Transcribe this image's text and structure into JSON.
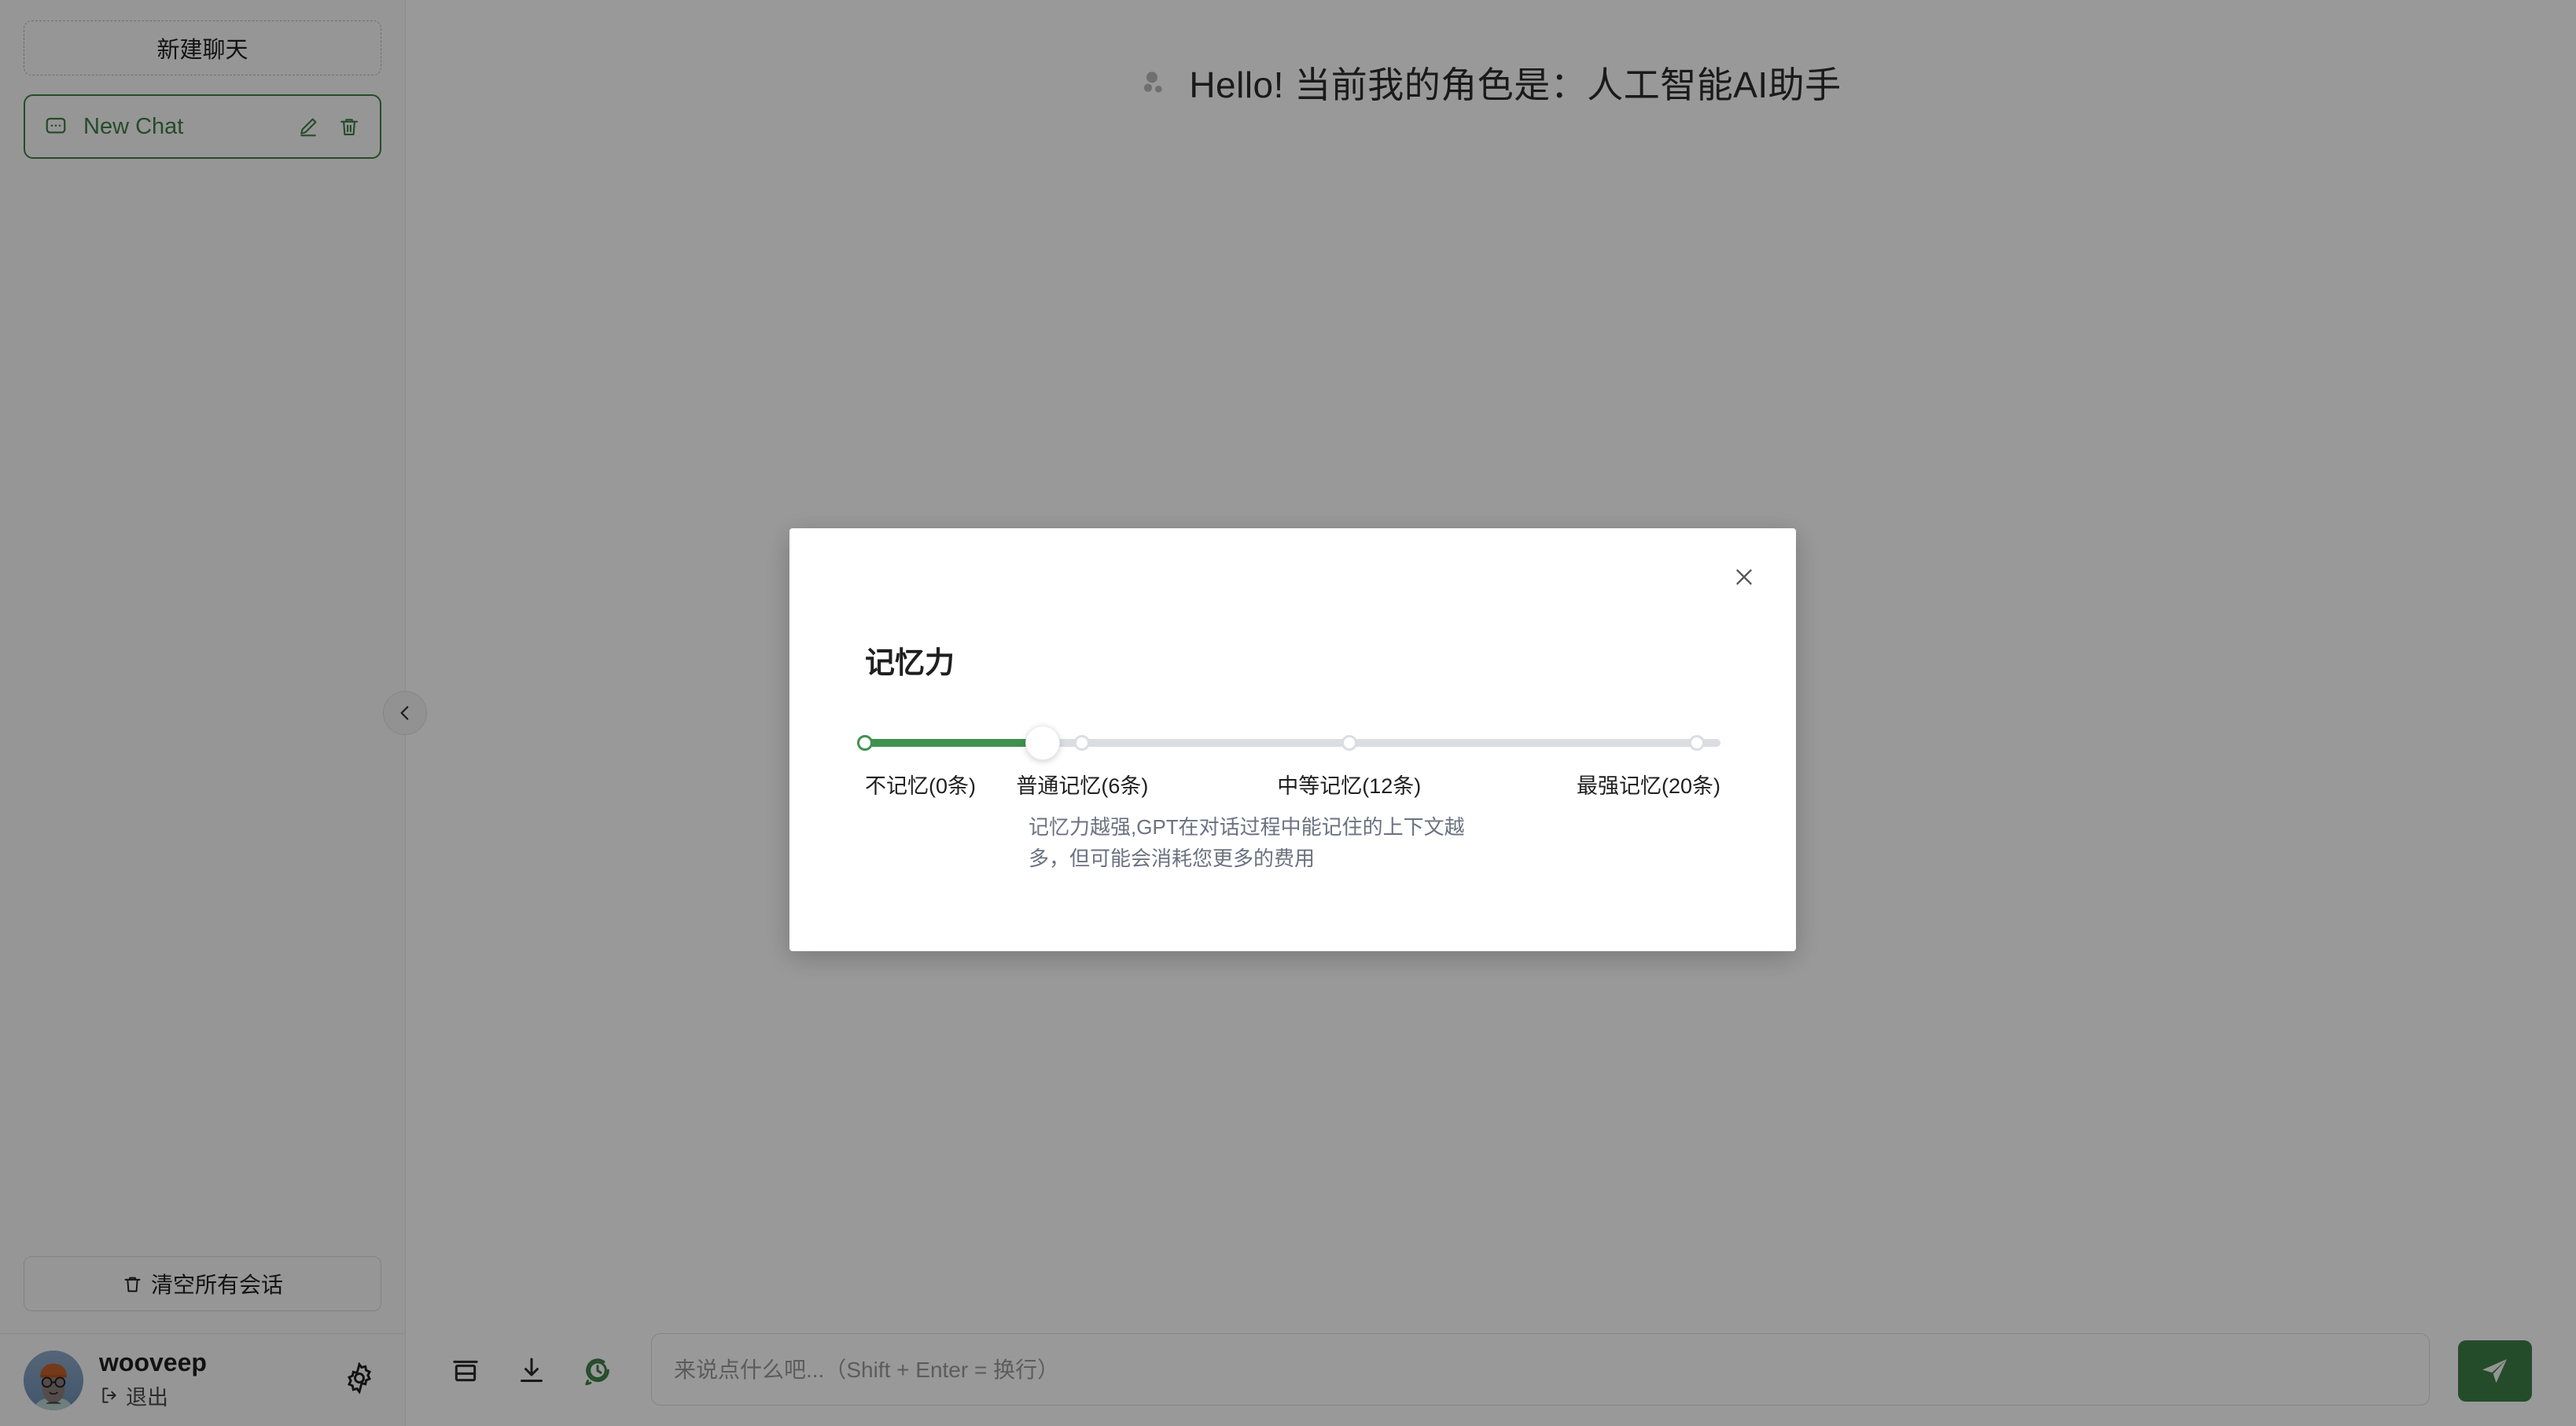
{
  "sidebar": {
    "new_chat_button": "新建聊天",
    "chat_items": [
      {
        "title": "New Chat",
        "chat_icon": "chat-bubble-icon",
        "edit_icon": "pencil-icon",
        "delete_icon": "trash-icon",
        "active": true
      }
    ],
    "clear_all_button": "清空所有会话",
    "clear_icon": "trash-icon",
    "user": {
      "name": "wooveep",
      "logout_label": "退出",
      "logout_icon": "sign-out-icon",
      "avatar_icon": "user-avatar",
      "settings_icon": "gear-icon"
    },
    "collapse_icon": "chevron-left-icon",
    "accent_color": "#3f7f47"
  },
  "main": {
    "greeting": "Hello! 当前我的角色是：人工智能AI助手",
    "greeting_icon": "dots-cluster-icon",
    "composer": {
      "tools": [
        {
          "name": "archive-icon",
          "label": "存档"
        },
        {
          "name": "download-icon",
          "label": "下载"
        },
        {
          "name": "history-clock-icon",
          "label": "历史"
        }
      ],
      "input_value": "",
      "input_placeholder": "来说点什么吧...（Shift + Enter = 换行）",
      "send_icon": "send-paper-plane-icon",
      "send_color": "#3f7f47"
    }
  },
  "modal": {
    "title": "记忆力",
    "close_icon": "close-x-icon",
    "slider": {
      "value": 6,
      "min": 0,
      "max": 20,
      "fill_color": "#3f9150",
      "track_color": "#dcdde1",
      "ticks": [
        {
          "label": "不记忆(0条)",
          "value": 0,
          "position_pct": 0
        },
        {
          "label": "普通记忆(6条)",
          "value": 6,
          "position_pct": 25.4
        },
        {
          "label": "中等记忆(12条)",
          "value": 12,
          "position_pct": 56.6
        },
        {
          "label": "最强记忆(20条)",
          "value": 20,
          "position_pct": 97.2
        }
      ],
      "handle_position_pct": 20.8
    },
    "description": "记忆力越强,GPT在对话过程中能记住的上下文越多，但可能会消耗您更多的费用"
  }
}
